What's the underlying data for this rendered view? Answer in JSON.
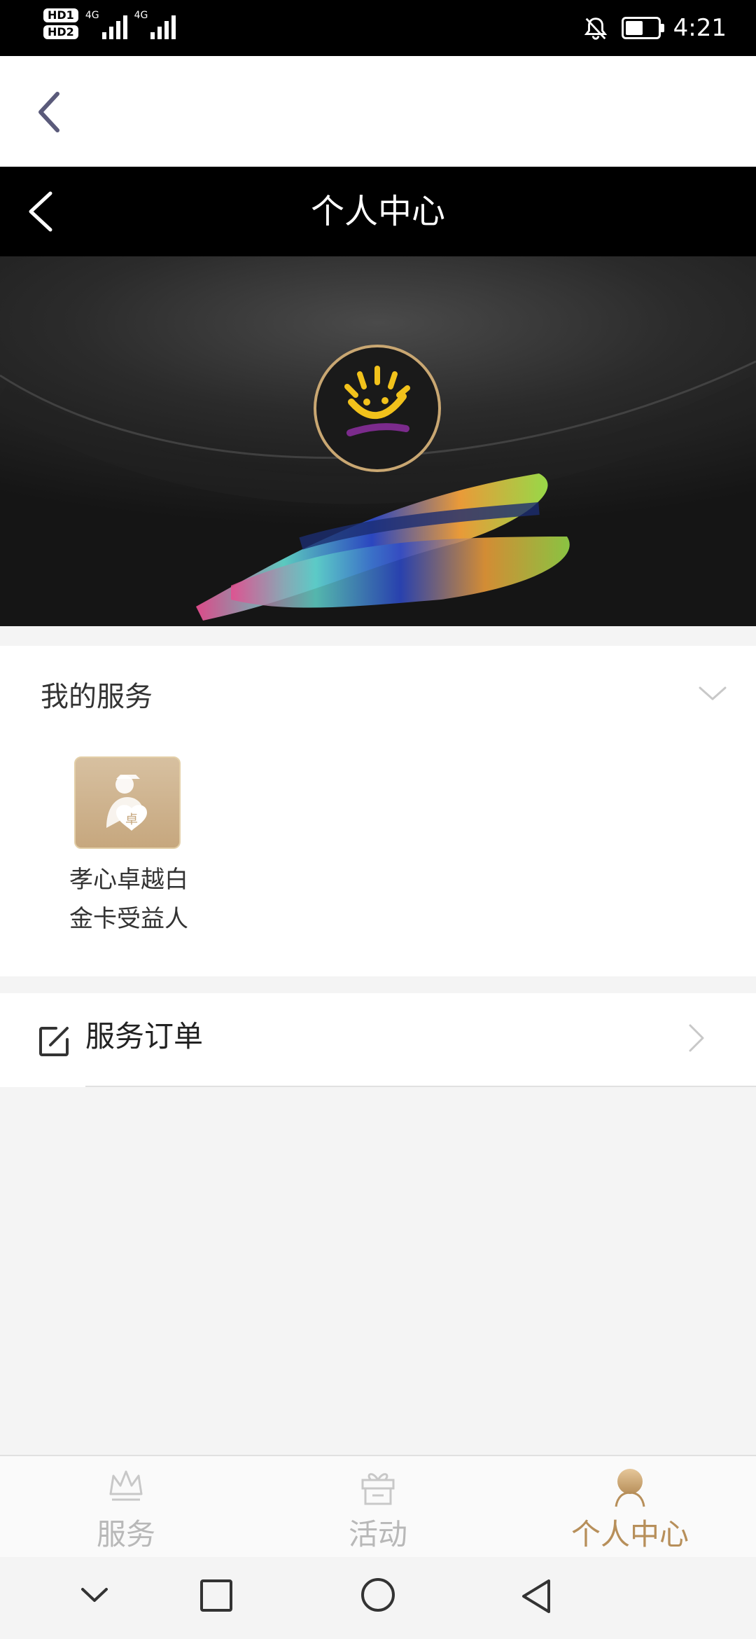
{
  "status_bar": {
    "hd1": "HD1",
    "hd2": "HD2",
    "net1": "4G",
    "net2": "4G",
    "time": "4:21"
  },
  "page": {
    "title": "个人中心"
  },
  "services": {
    "section_title": "我的服务",
    "items": [
      {
        "label_line1": "孝心卓越白",
        "label_line2": "金卡受益人",
        "icon": "elder-care-icon"
      }
    ]
  },
  "orders": {
    "label": "服务订单",
    "icon": "edit-icon"
  },
  "tabbar": {
    "items": [
      {
        "label": "服务",
        "icon": "crown-icon",
        "active": false
      },
      {
        "label": "活动",
        "icon": "gift-icon",
        "active": false
      },
      {
        "label": "个人中心",
        "icon": "person-icon",
        "active": true
      }
    ]
  },
  "colors": {
    "accent": "#b78f5a",
    "inactive": "#b8b8b8",
    "titlebar": "#000000"
  }
}
